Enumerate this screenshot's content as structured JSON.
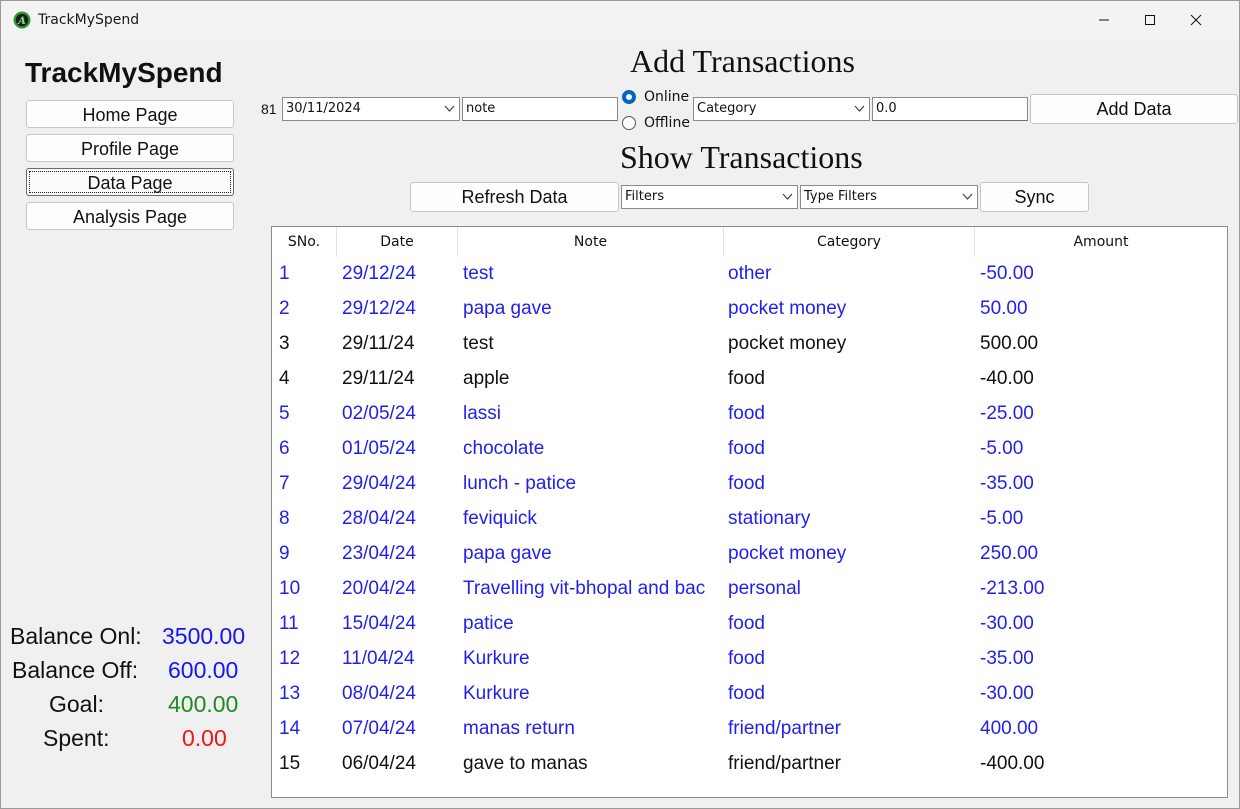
{
  "window": {
    "title": "TrackMySpend"
  },
  "sidebar": {
    "brand": "TrackMySpend",
    "nav": [
      {
        "label": "Home Page",
        "active": false
      },
      {
        "label": "Profile Page",
        "active": false
      },
      {
        "label": "Data Page",
        "active": true
      },
      {
        "label": "Analysis Page",
        "active": false
      }
    ],
    "stats": [
      {
        "label": "Balance Onl:",
        "value": "3500.00",
        "color": "#1515ee"
      },
      {
        "label": "Balance Off:",
        "value": "600.00",
        "color": "#1515ee"
      },
      {
        "label": "Goal:",
        "value": "400.00",
        "color": "#1f8a1f"
      },
      {
        "label": "Spent:",
        "value": "0.00",
        "color": "#ee1515"
      }
    ]
  },
  "add_section": {
    "heading": "Add Transactions",
    "count": "81",
    "date_value": "30/11/2024",
    "note_value": "note",
    "mode_options": [
      {
        "label": "Online",
        "selected": true
      },
      {
        "label": "Offline",
        "selected": false
      }
    ],
    "category_value": "Category",
    "amount_value": "0.0",
    "add_button": "Add Data"
  },
  "show_section": {
    "heading": "Show Transactions",
    "refresh_button": "Refresh Data",
    "filters_value": "Filters",
    "type_filters_value": "Type Filters",
    "sync_button": "Sync"
  },
  "table": {
    "columns": [
      "SNo.",
      "Date",
      "Note",
      "Category",
      "Amount"
    ],
    "online_color": "#1f1fee",
    "offline_color": "#111111",
    "rows": [
      {
        "sno": "1",
        "date": "29/12/24",
        "note": "test",
        "category": "other",
        "amount": "-50.00",
        "online": true
      },
      {
        "sno": "2",
        "date": "29/12/24",
        "note": "papa gave",
        "category": "pocket money",
        "amount": "50.00",
        "online": true
      },
      {
        "sno": "3",
        "date": "29/11/24",
        "note": "test",
        "category": "pocket money",
        "amount": "500.00",
        "online": false
      },
      {
        "sno": "4",
        "date": "29/11/24",
        "note": "apple",
        "category": "food",
        "amount": "-40.00",
        "online": false
      },
      {
        "sno": "5",
        "date": "02/05/24",
        "note": "lassi",
        "category": "food",
        "amount": "-25.00",
        "online": true
      },
      {
        "sno": "6",
        "date": "01/05/24",
        "note": "chocolate",
        "category": "food",
        "amount": "-5.00",
        "online": true
      },
      {
        "sno": "7",
        "date": "29/04/24",
        "note": "lunch - patice",
        "category": "food",
        "amount": "-35.00",
        "online": true
      },
      {
        "sno": "8",
        "date": "28/04/24",
        "note": "feviquick",
        "category": "stationary",
        "amount": "-5.00",
        "online": true
      },
      {
        "sno": "9",
        "date": "23/04/24",
        "note": "papa gave",
        "category": "pocket money",
        "amount": "250.00",
        "online": true
      },
      {
        "sno": "10",
        "date": "20/04/24",
        "note": "Travelling vit-bhopal and bac",
        "category": "personal",
        "amount": "-213.00",
        "online": true
      },
      {
        "sno": "11",
        "date": "15/04/24",
        "note": "patice",
        "category": "food",
        "amount": "-30.00",
        "online": true
      },
      {
        "sno": "12",
        "date": "11/04/24",
        "note": "Kurkure",
        "category": "food",
        "amount": "-35.00",
        "online": true
      },
      {
        "sno": "13",
        "date": "08/04/24",
        "note": "Kurkure",
        "category": "food",
        "amount": "-30.00",
        "online": true
      },
      {
        "sno": "14",
        "date": "07/04/24",
        "note": "manas return",
        "category": "friend/partner",
        "amount": "400.00",
        "online": true
      },
      {
        "sno": "15",
        "date": "06/04/24",
        "note": "gave to manas",
        "category": "friend/partner",
        "amount": "-400.00",
        "online": false
      }
    ]
  },
  "colors": {
    "accent": "#0067c0"
  }
}
